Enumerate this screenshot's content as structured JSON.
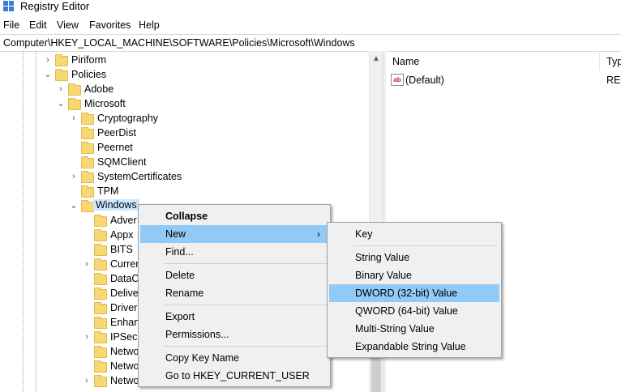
{
  "window": {
    "title": "Registry Editor"
  },
  "menu": [
    "File",
    "Edit",
    "View",
    "Favorites",
    "Help"
  ],
  "address": "Computer\\HKEY_LOCAL_MACHINE\\SOFTWARE\\Policies\\Microsoft\\Windows",
  "tree": {
    "items": [
      {
        "label": "Piriform",
        "expander": "›"
      },
      {
        "label": "Policies",
        "expander": "⌄"
      },
      {
        "label": "Adobe",
        "expander": "›"
      },
      {
        "label": "Microsoft",
        "expander": "⌄"
      },
      {
        "label": "Cryptography",
        "expander": "›"
      },
      {
        "label": "PeerDist",
        "expander": ""
      },
      {
        "label": "Peernet",
        "expander": ""
      },
      {
        "label": "SQMClient",
        "expander": ""
      },
      {
        "label": "SystemCertificates",
        "expander": "›"
      },
      {
        "label": "TPM",
        "expander": ""
      },
      {
        "label": "Windows",
        "expander": "⌄"
      },
      {
        "label": "Adver",
        "expander": ""
      },
      {
        "label": "Appx",
        "expander": ""
      },
      {
        "label": "BITS",
        "expander": ""
      },
      {
        "label": "Curren",
        "expander": "›"
      },
      {
        "label": "DataC",
        "expander": ""
      },
      {
        "label": "Delive",
        "expander": ""
      },
      {
        "label": "Driver",
        "expander": ""
      },
      {
        "label": "Enhan",
        "expander": ""
      },
      {
        "label": "IPSec",
        "expander": "›"
      },
      {
        "label": "Netwo",
        "expander": ""
      },
      {
        "label": "Netwo",
        "expander": ""
      },
      {
        "label": "Netwo",
        "expander": "›"
      }
    ]
  },
  "list": {
    "columns": [
      "Name",
      "Typ"
    ],
    "rows": [
      {
        "name": "(Default)",
        "type": "REG",
        "icon": "ab"
      }
    ]
  },
  "context_menu": {
    "items": [
      "Collapse",
      "New",
      "Find...",
      "Delete",
      "Rename",
      "Export",
      "Permissions...",
      "Copy Key Name",
      "Go to HKEY_CURRENT_USER"
    ],
    "submenu_arrow": "›"
  },
  "submenu": {
    "items": [
      "Key",
      "String Value",
      "Binary Value",
      "DWORD (32-bit) Value",
      "QWORD (64-bit) Value",
      "Multi-String Value",
      "Expandable String Value"
    ]
  },
  "colors": {
    "highlight": "#91c9f7",
    "selection": "#cce8ff",
    "folder": "#f8d775"
  }
}
